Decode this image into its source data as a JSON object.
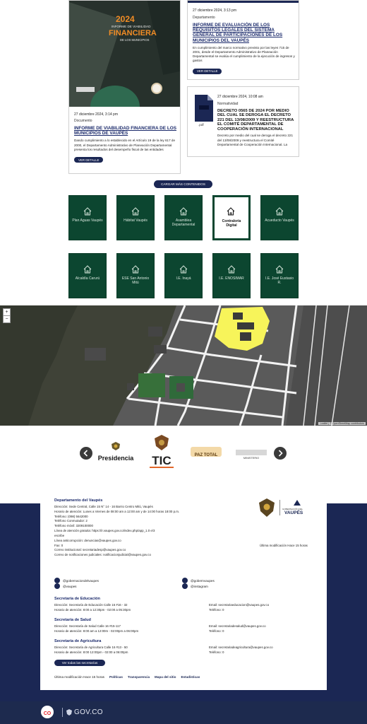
{
  "cards": {
    "financiera": {
      "cover_year": "2024",
      "cover_line1": "INFORME DE VIABILIDAD",
      "cover_line2": "FINANCIERA",
      "cover_line3": "DE LOS MUNICIPIOS",
      "date": "27 diciembre 2024, 3:14 pm",
      "type": "Documento",
      "title": "INFORME DE VIABILIDAD FINANCIERA DE LOS MUNICIPIOS DE VAUPÉS",
      "description": "Dando cumplimiento a lo establecido en el Artículo 19 de la ley 617 de 2000, el Departamento Administrativo de Planeación Departamental presenta los resultados del desempeño fiscal de las entidades",
      "button": "VER DETALLE"
    },
    "requisitos": {
      "date": "27 diciembre 2024, 3:13 pm",
      "type": "Departamento",
      "title": "INFORME DE EVALUACIÓN DE LOS REQUISITOS LEGALES DEL SISTEMA GENERAL DE PARTICIPACIONES DE LOS MUNICIPIOS DEL VAUPÉS",
      "description": "En cumplimiento del marco normativo previsto por las leyes 715 de 2001, desde el Departamento Administrativo de Planeación Departamental se evalúa el cumplimiento de la ejecución de ingresos y gastos",
      "button": "VER DETALLE"
    },
    "decreto": {
      "date": "27 diciembre 2024, 10:08 am",
      "type": "Normatividad",
      "file_label": ".pdf",
      "title": "DECRETO 0565 DE 2024 POR MEDIO DEL CUAL SE DEROGA EL DECRETO 221 DEL 13/08/2009 Y REESTRUCTURA EL COMITÉ DEPARTAMENTAL DE COOPERACIÓN INTERNACIONAL",
      "description": "Decreto por medio del cual se deroga el decreto 221 del 13/08/2009 y reestructura el Comité Departamental de Cooperación Internacional. La acción para actualizar su estructura y funcionamiento y"
    }
  },
  "load_more": "CARGAR MÁS CONTENIDOS",
  "tiles": [
    {
      "label": "Plan Aguas Vaupés",
      "active": false
    },
    {
      "label": "Hábitat Vaupés",
      "active": false
    },
    {
      "label": "Asamblea Departamental",
      "active": false
    },
    {
      "label": "Contraloría Digital",
      "active": true
    },
    {
      "label": "Acueducto Vaupés",
      "active": false
    },
    {
      "label": "Alcaldía Carurú",
      "active": false
    },
    {
      "label": "ESE San Antonio Mitú",
      "active": false
    },
    {
      "label": "I.E. Inayá",
      "active": false
    },
    {
      "label": "I.E. ENOSIMAR",
      "active": false
    },
    {
      "label": "I.E. José Eustasio R.",
      "active": false
    }
  ],
  "map": {
    "zoom_in": "+",
    "zoom_out": "−",
    "attribution": "Leaflet | © OpenStreetMap contributors"
  },
  "carousel": {
    "logos": [
      "Presidencia",
      "TIC",
      "PAZ TOTAL",
      "MINISTERIO"
    ]
  },
  "footer": {
    "entity": "Departamento del Vaupés",
    "address": "Dirección: Sede Central, Calle 15 N° 14 - 16 Barrio Centro Mitú, Vaupés",
    "hours": "Horario de atención: Lunes a Viernes de 08:00 am a 12:00 am y de 14:00 horas 18:00 p.m.",
    "phone1": "Teléfono: (098) 5642000",
    "phone2": "Teléfono Conmutador: 2",
    "phone3": "Teléfono móvil: 3209100000",
    "link_rights": "Línea de atención gratuita: https://ir.vaupes.gov.co/index.php/app_1.0 e/3",
    "email_label": "escribe",
    "email_contacto": "Línea anticorrupción: denuncias@vaupes.gov.co",
    "fax": "Fax: 0",
    "email1": "Correo institucional: secretariadesp@vaupes.gov.co",
    "email2": "Correo de notificaciones judiciales: notificacionjudicial@vaupes.gov.co",
    "last_mod_right": "Última modificación Hace 15 horas",
    "social": [
      {
        "label": "@gobernaciondelvaupes",
        "icon": "facebook-icon"
      },
      {
        "label": "@gobernvaupes",
        "icon": "x-icon"
      },
      {
        "label": "@vaupes",
        "icon": "youtube-icon"
      },
      {
        "label": "@instagram",
        "icon": "instagram-icon"
      }
    ],
    "secretarias": [
      {
        "title": "Secretaría de Educación",
        "address": "Dirección: Secretaría de Educación Calle 16 #16 - 32",
        "hours": "Horario de atención: 8:00 a 12:30pm - 02:00 a 05:30pm",
        "email": "Email: secretariaeducacion@vaupes.gov.co",
        "phone": "Teléfono: 0"
      },
      {
        "title": "Secretaría de Salud",
        "address": "Dirección: Secretaría de Salud Calle 16 #15-117",
        "hours": "Horario de atención: 8:00 am a 12:00m - 02:00pm a 06:00pm",
        "email": "Email: secretariadesalud@vaupes.gov.co",
        "phone": "Teléfono: 0"
      },
      {
        "title": "Secretaría de Agricultura",
        "address": "Dirección: Secretaría de Agricultura Calle 16 #13 - 50",
        "hours": "Horario de atención: 8:00 12:00pm - 02:00 a 06:00pm",
        "email": "Email: secretariadeagricultura@vaupes.gov.co",
        "phone": "Teléfono: 0"
      }
    ],
    "directory_button": "Ver todas las secretarías",
    "bottom_last_mod": "Última modificación Hace 15 horas",
    "links": [
      "Políticas",
      "Transparencia",
      "Mapa del sitio",
      "Estadísticas"
    ],
    "logo_text": "VAUPÉS",
    "logo_sub": "GOBERNACIÓN DEL"
  },
  "govbar": {
    "co": "CO",
    "gov": "GOV.CO"
  },
  "colors": {
    "navy": "#1b2754",
    "green": "#0c4630",
    "map_green": "#37703a",
    "highlight": "#f7f45a"
  }
}
